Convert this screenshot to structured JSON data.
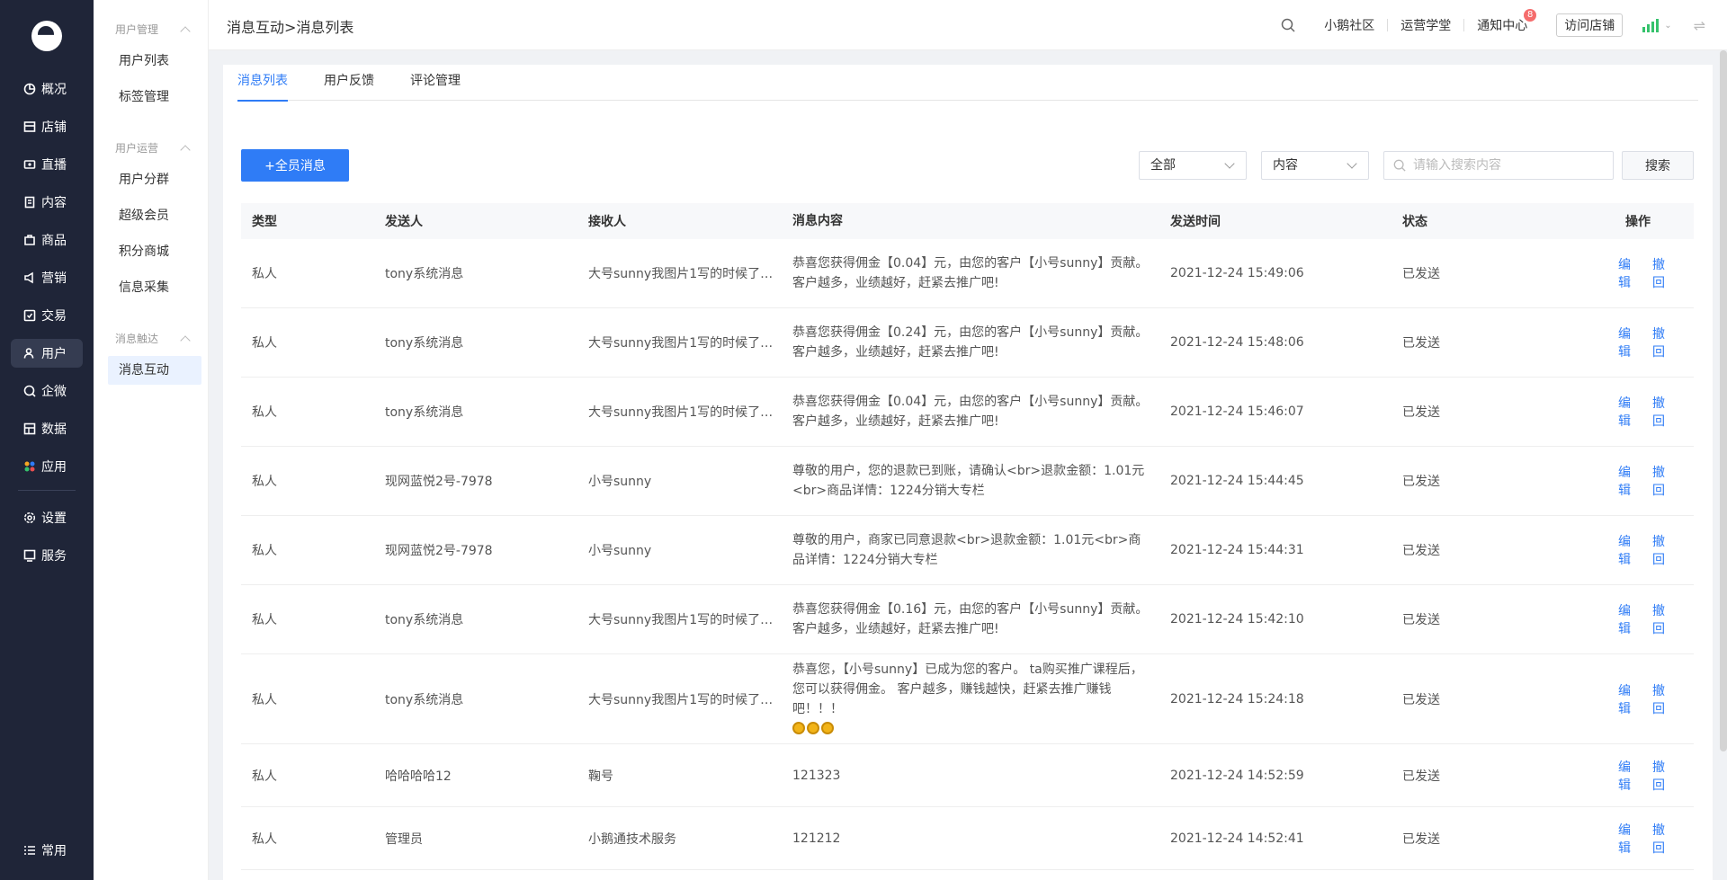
{
  "nav": {
    "items": [
      {
        "label": "概况",
        "icon": "pie-chart-icon"
      },
      {
        "label": "店铺",
        "icon": "store-icon"
      },
      {
        "label": "直播",
        "icon": "live-icon"
      },
      {
        "label": "内容",
        "icon": "document-icon"
      },
      {
        "label": "商品",
        "icon": "goods-icon"
      },
      {
        "label": "营销",
        "icon": "megaphone-icon"
      },
      {
        "label": "交易",
        "icon": "trade-icon"
      },
      {
        "label": "用户",
        "icon": "user-icon"
      },
      {
        "label": "企微",
        "icon": "wecom-icon"
      },
      {
        "label": "数据",
        "icon": "data-icon"
      },
      {
        "label": "应用",
        "icon": "apps-icon"
      },
      {
        "label": "设置",
        "icon": "gear-icon"
      },
      {
        "label": "服务",
        "icon": "service-icon"
      }
    ],
    "bottom": {
      "label": "常用",
      "icon": "list-icon"
    }
  },
  "subnav": {
    "groups": [
      {
        "title": "用户管理",
        "items": [
          "用户列表",
          "标签管理"
        ]
      },
      {
        "title": "用户运营",
        "items": [
          "用户分群",
          "超级会员",
          "积分商城",
          "信息采集"
        ]
      },
      {
        "title": "消息触达",
        "items": [
          "消息互动"
        ]
      }
    ]
  },
  "topbar": {
    "breadcrumb": "消息互动>消息列表",
    "links": [
      "小鹅社区",
      "运营学堂",
      "通知中心"
    ],
    "notify_badge": "8",
    "visit_label": "访问店铺"
  },
  "tabs": [
    "消息列表",
    "用户反馈",
    "评论管理"
  ],
  "toolbar": {
    "new_button": "+全员消息",
    "filter_type": "全部",
    "filter_field": "内容",
    "search_placeholder": "请输入搜索内容",
    "search_button": "搜索"
  },
  "table": {
    "headers": [
      "类型",
      "发送人",
      "接收人",
      "消息内容",
      "发送时间",
      "状态",
      "操作"
    ],
    "actions": {
      "edit": "编辑",
      "revoke": "撤回"
    },
    "rows": [
      {
        "type": "私人",
        "sender": "tony系统消息",
        "receiver": "大号sunny我图片1写的时候了吧...",
        "content": "恭喜您获得佣金【0.04】元，由您的客户【小号sunny】贡献。客户越多，业绩越好，赶紧去推广吧!",
        "time": "2021-12-24 15:49:06",
        "status": "已发送"
      },
      {
        "type": "私人",
        "sender": "tony系统消息",
        "receiver": "大号sunny我图片1写的时候了吧...",
        "content": "恭喜您获得佣金【0.24】元，由您的客户【小号sunny】贡献。客户越多，业绩越好，赶紧去推广吧!",
        "time": "2021-12-24 15:48:06",
        "status": "已发送"
      },
      {
        "type": "私人",
        "sender": "tony系统消息",
        "receiver": "大号sunny我图片1写的时候了吧...",
        "content": "恭喜您获得佣金【0.04】元，由您的客户【小号sunny】贡献。客户越多，业绩越好，赶紧去推广吧!",
        "time": "2021-12-24 15:46:07",
        "status": "已发送"
      },
      {
        "type": "私人",
        "sender": "现网蓝悦2号-7978",
        "receiver": "小号sunny",
        "content": "尊敬的用户，您的退款已到账，请确认<br>退款金额：1.01元<br>商品详情：1224分销大专栏",
        "time": "2021-12-24 15:44:45",
        "status": "已发送"
      },
      {
        "type": "私人",
        "sender": "现网蓝悦2号-7978",
        "receiver": "小号sunny",
        "content": "尊敬的用户，商家已同意退款<br>退款金额：1.01元<br>商品详情：1224分销大专栏",
        "time": "2021-12-24 15:44:31",
        "status": "已发送"
      },
      {
        "type": "私人",
        "sender": "tony系统消息",
        "receiver": "大号sunny我图片1写的时候了吧...",
        "content": "恭喜您获得佣金【0.16】元，由您的客户【小号sunny】贡献。客户越多，业绩越好，赶紧去推广吧!",
        "time": "2021-12-24 15:42:10",
        "status": "已发送"
      },
      {
        "type": "私人",
        "sender": "tony系统消息",
        "receiver": "大号sunny我图片1写的时候了吧...",
        "content": "恭喜您，【小号sunny】已成为您的客户。 ta购买推广课程后，您可以获得佣金。 客户越多，赚钱越快，赶紧去推广赚钱吧！！！",
        "time": "2021-12-24 15:24:18",
        "status": "已发送",
        "coins": 3
      },
      {
        "type": "私人",
        "sender": "哈哈哈哈12",
        "receiver": "鞠号",
        "content": "121323",
        "time": "2021-12-24 14:52:59",
        "status": "已发送"
      },
      {
        "type": "私人",
        "sender": "管理员",
        "receiver": "小鹅通技术服务",
        "content": "121212",
        "time": "2021-12-24 14:52:41",
        "status": "已发送"
      }
    ]
  }
}
